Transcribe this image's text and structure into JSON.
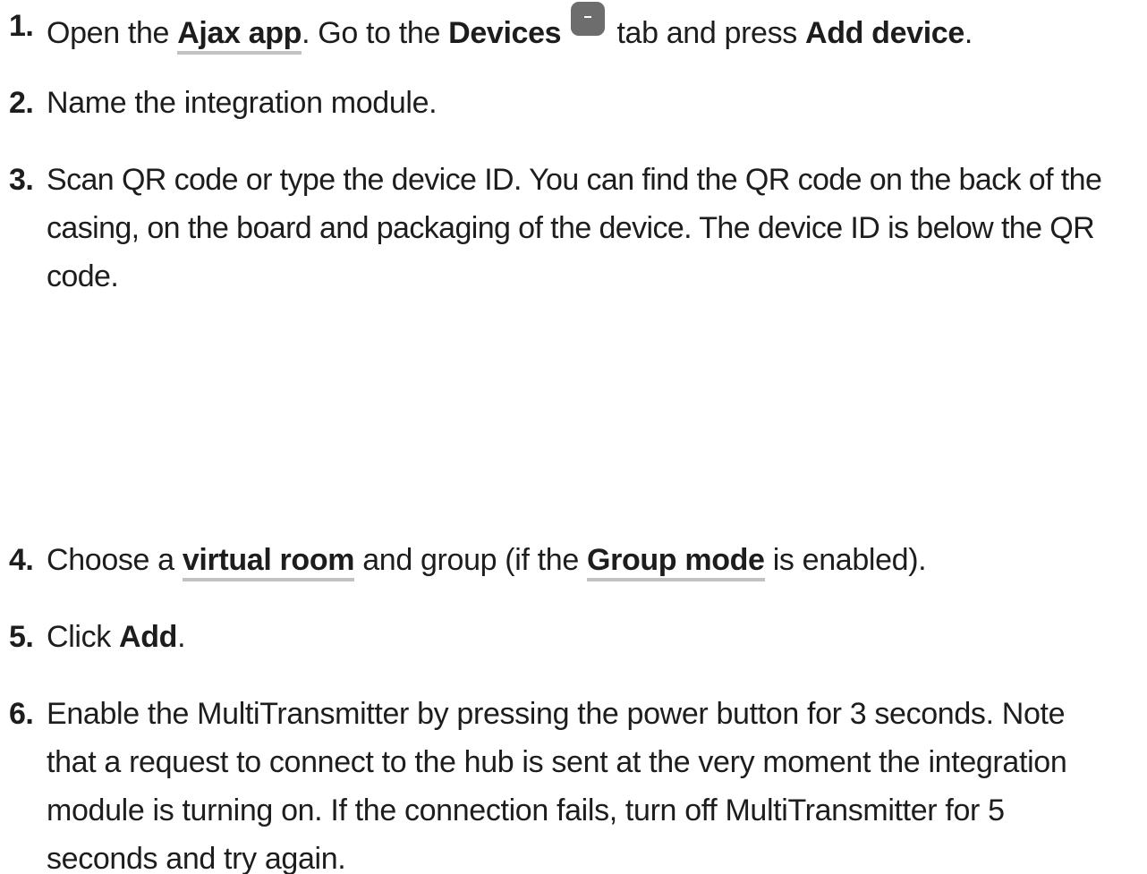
{
  "steps": [
    {
      "number": "1.",
      "t1": "Open the ",
      "link": "Ajax app",
      "t2": ". Go to the ",
      "b1": "Devices",
      "icon": "devices-tab-icon",
      "t3": " tab and press ",
      "b2": "Add device",
      "t4": "."
    },
    {
      "number": "2.",
      "text": "Name the integration module."
    },
    {
      "number": "3.",
      "text": "Scan QR code or type the device ID. You can find the QR code on the back of the casing, on the board and packaging of the device. The device ID is below the QR code."
    },
    {
      "number": "4.",
      "t1": "Choose a ",
      "link1": "virtual room",
      "t2": " and group (if the ",
      "link2": "Group mode",
      "t3": " is enabled)."
    },
    {
      "number": "5.",
      "t1": "Click ",
      "b1": "Add",
      "t2": "."
    },
    {
      "number": "6.",
      "text": "Enable the MultiTransmitter by pressing the power button for 3 seconds. Note that a request to connect to the hub is sent at the very moment the integration module is turning on. If the connection fails, turn off MultiTransmitter for 5 seconds and try again."
    }
  ],
  "colors": {
    "text": "#1d1d1d",
    "link_underline": "#c2c2c2",
    "icon_bg": "#6d6d6d"
  }
}
